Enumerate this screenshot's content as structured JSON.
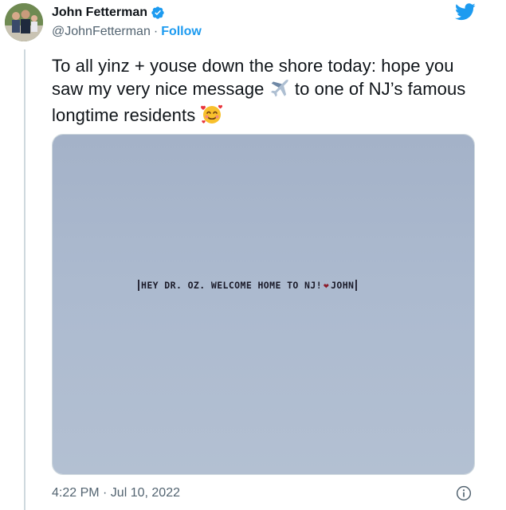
{
  "author": {
    "display_name": "John Fetterman",
    "handle": "@JohnFetterman",
    "separator": "·",
    "follow_label": "Follow",
    "verified": true
  },
  "tweet": {
    "text_before_plane": "To all yinz + youse down the shore today:  hope you saw my very nice message ",
    "text_after_plane": " to one of NJ’s famous longtime residents ",
    "plane_emoji": "✈️",
    "smile_emoji": "🥰"
  },
  "media": {
    "banner_part1": "HEY DR. OZ. WELCOME HOME TO NJ!",
    "banner_heart": "❤",
    "banner_part2": "JOHN"
  },
  "footer": {
    "timestamp": "4:22 PM · Jul 10, 2022"
  },
  "icons": {
    "brand": "twitter-bird-icon",
    "verified": "verified-badge-icon",
    "info": "info-icon"
  },
  "colors": {
    "accent": "#1d9bf0",
    "text_primary": "#0f1419",
    "text_secondary": "#536471",
    "border": "#cfd9de"
  }
}
